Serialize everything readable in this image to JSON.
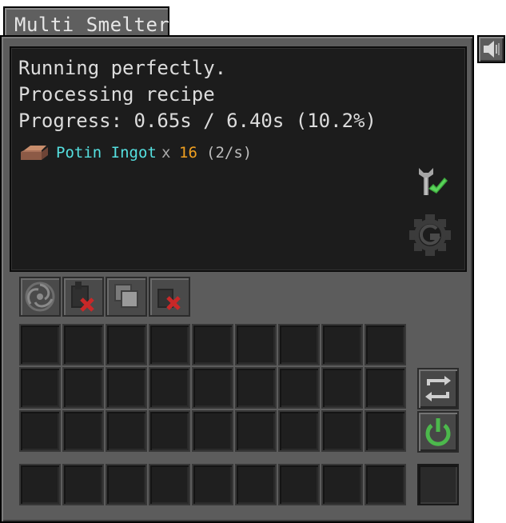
{
  "window": {
    "title": "Multi Smelter"
  },
  "status": {
    "lines": [
      "Running perfectly.",
      "Processing recipe",
      "Progress: 0.65s / 6.40s (10.2%)"
    ],
    "progress_fraction": 0.102,
    "output": {
      "icon": "ingot-icon",
      "name": "Potin Ingot",
      "multiplier": "x",
      "count": "16",
      "rate": "(2/s)"
    },
    "indicators": [
      "wrench-check-icon",
      "gear-icon"
    ]
  },
  "filter_tabs": [
    "vortex-filter-icon",
    "block-deny-icon",
    "stack-filter-icon",
    "item-deny-icon"
  ],
  "grid": {
    "rows": 3,
    "cols": 9
  },
  "bottom_row": {
    "cols": 9
  },
  "side_buttons": [
    "cycle-icon",
    "power-icon"
  ],
  "colors": {
    "item_name": "#55e0e0",
    "count": "#f0a020",
    "power_on": "#4cb84c",
    "check": "#44bb44",
    "deny": "#d03030"
  }
}
